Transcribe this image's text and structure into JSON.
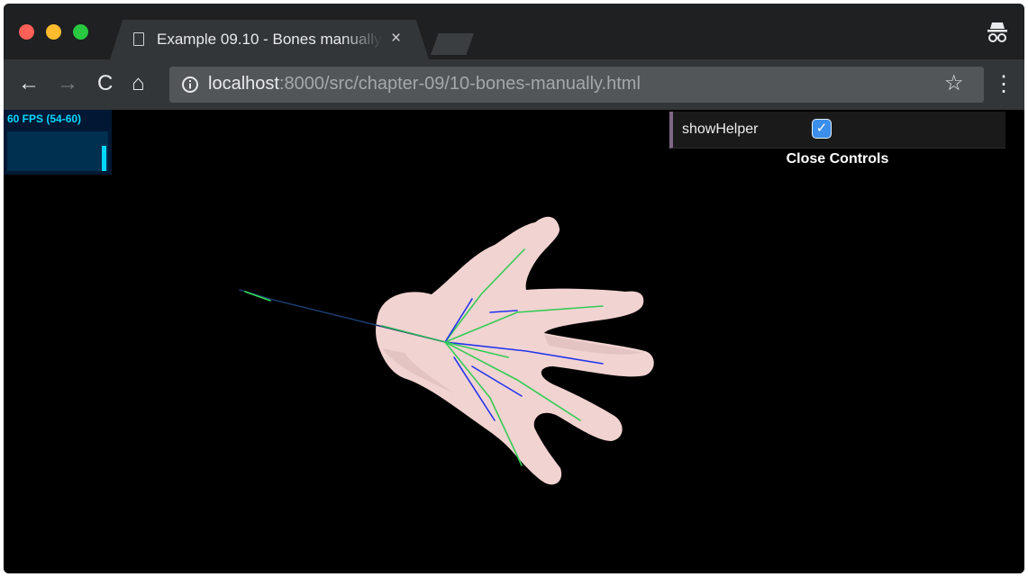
{
  "browser": {
    "tab_title": "Example 09.10 - Bones manually",
    "tab_close": "×",
    "url_host": "localhost",
    "url_rest": ":8000/src/chapter-09/10-bones-manually.html",
    "nav": {
      "back": "←",
      "forward": "→",
      "reload": "C",
      "home": "⌂",
      "star": "☆",
      "menu": "⋮"
    }
  },
  "stats": {
    "fps_text": "60 FPS (54-60)"
  },
  "gui": {
    "show_helper_label": "showHelper",
    "show_helper_checked": true,
    "check_glyph": "✓",
    "close_label": "Close Controls"
  },
  "colors": {
    "fps": "#00d7ff",
    "gui_accent": "#806787",
    "checkbox": "#3b8eea",
    "skin": "#f2cfcc",
    "bone_green": "#22cc44",
    "bone_blue": "#2233ee"
  }
}
